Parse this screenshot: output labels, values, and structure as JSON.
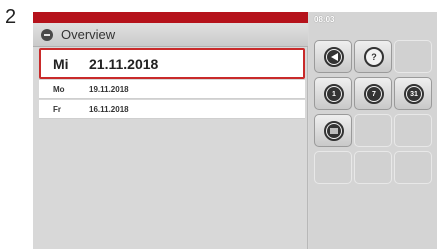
{
  "step_number": "2",
  "header": {
    "title": "Overview",
    "icon": "minus-circle-icon"
  },
  "status": {
    "time": "08:03"
  },
  "dates": [
    {
      "day": "Mi",
      "date": "21.11.2018",
      "selected": true
    },
    {
      "day": "Mo",
      "date": "19.11.2018",
      "selected": false
    },
    {
      "day": "Fr",
      "date": "16.11.2018",
      "selected": false
    }
  ],
  "buttons": {
    "back": {
      "icon": "arrow-left-icon"
    },
    "help": {
      "label": "?"
    },
    "day_1": {
      "label": "1"
    },
    "day_7": {
      "label": "7"
    },
    "day_31": {
      "label": "31"
    },
    "list": {
      "icon": "list-icon"
    }
  },
  "colors": {
    "accent": "#b5121b",
    "selection": "#c92a2a",
    "panel": "#d8d8d8"
  }
}
